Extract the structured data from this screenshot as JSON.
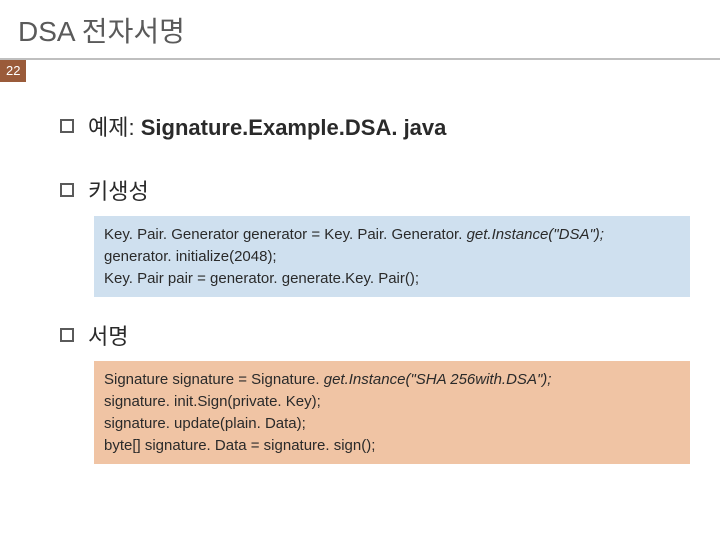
{
  "title": "DSA 전자서명",
  "page_number": "22",
  "bullets": {
    "b1_prefix": "예제: ",
    "b1_bold": "Signature.Example.DSA. java",
    "b2": "키생성",
    "b3": "서명"
  },
  "code1": {
    "l1a": "Key. Pair. Generator generator = Key. Pair. Generator. ",
    "l1b": "get.Instance(\"DSA\");",
    "l2": "generator. initialize(2048);",
    "l3": "Key. Pair pair = generator. generate.Key. Pair();"
  },
  "code2": {
    "l1a": "Signature signature = Signature. ",
    "l1b": "get.Instance(\"SHA 256with.DSA\");",
    "l2": "signature. init.Sign(private. Key);",
    "l3": "signature. update(plain. Data);",
    "l4": "byte[] signature. Data = signature. sign();"
  }
}
